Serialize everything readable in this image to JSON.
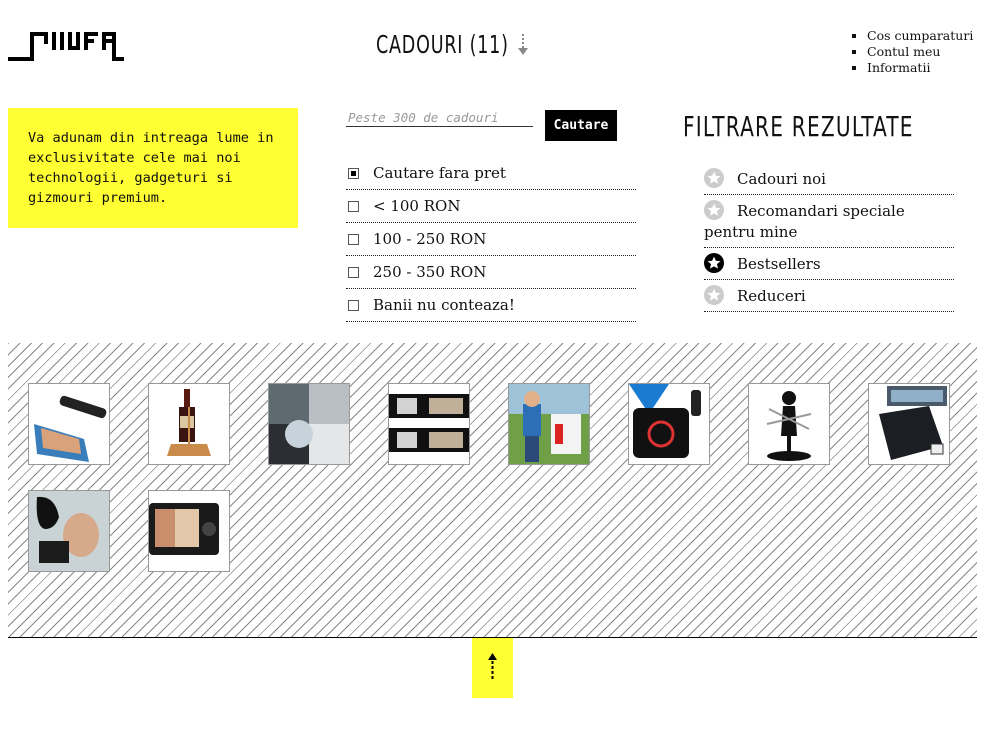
{
  "header": {
    "logo_alt": "Stuff",
    "title": "CADOURI (11)"
  },
  "top_nav": [
    "Cos cumparaturi",
    "Contul meu",
    "Informatii"
  ],
  "intro": {
    "text": "Va adunam din intreaga lume in exclusivitate cele mai noi technologii, gadgeturi si gizmouri premium."
  },
  "search": {
    "placeholder": "Peste 300 de cadouri",
    "value": "",
    "button_label": "Cautare"
  },
  "price_filters": [
    {
      "label": "Cautare fara pret",
      "checked": true
    },
    {
      "label": "< 100 RON",
      "checked": false
    },
    {
      "label": "100 - 250 RON",
      "checked": false
    },
    {
      "label": "250 - 350 RON",
      "checked": false
    },
    {
      "label": "Banii nu conteaza!",
      "checked": false
    }
  ],
  "filter": {
    "title": "FILTRARE REZULTATE",
    "items": [
      {
        "label": "Cadouri noi",
        "active": false
      },
      {
        "label": "Recomandari speciale pentru mine",
        "active": false
      },
      {
        "label": "Bestsellers",
        "active": true
      },
      {
        "label": "Reduceri",
        "active": false
      }
    ]
  },
  "products": [
    {
      "icon": "scanner-photo-thumb"
    },
    {
      "icon": "wine-holder-thumb"
    },
    {
      "icon": "photo-collage-thumb"
    },
    {
      "icon": "film-strip-thumb"
    },
    {
      "icon": "bubble-toy-thumb"
    },
    {
      "icon": "usb-gadget-thumb"
    },
    {
      "icon": "figure-knife-holder-thumb"
    },
    {
      "icon": "wifi-scale-thumb"
    },
    {
      "icon": "portable-shower-thumb"
    },
    {
      "icon": "digital-frame-thumb"
    }
  ],
  "colors": {
    "accent_yellow": "#ffff33",
    "button_black": "#000000",
    "star_inactive": "#cccccc",
    "star_active": "#000000"
  }
}
